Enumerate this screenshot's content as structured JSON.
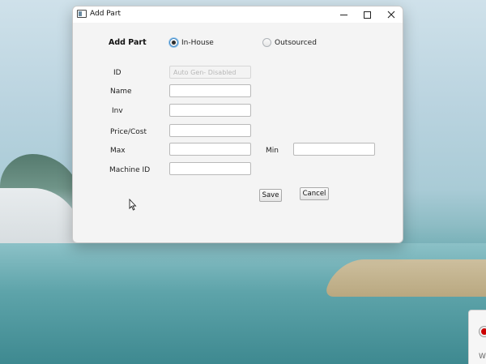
{
  "window": {
    "title": "Add Part",
    "controls": {
      "minimize": "minimize-icon",
      "maximize": "maximize-icon",
      "close": "close-icon"
    }
  },
  "form": {
    "heading": "Add Part",
    "radios": {
      "in_house": {
        "label": "In-House",
        "selected": true
      },
      "outsourced": {
        "label": "Outsourced",
        "selected": false
      }
    },
    "fields": {
      "id": {
        "label": "ID",
        "placeholder": "Auto Gen- Disabled",
        "value": ""
      },
      "name": {
        "label": "Name",
        "value": ""
      },
      "inv": {
        "label": "Inv",
        "value": ""
      },
      "price": {
        "label": "Price/Cost",
        "value": ""
      },
      "max": {
        "label": "Max",
        "value": ""
      },
      "min": {
        "label": "Min",
        "value": ""
      },
      "machine_id": {
        "label": "Machine ID",
        "value": ""
      }
    },
    "buttons": {
      "save": "Save",
      "cancel": "Cancel"
    }
  },
  "taskbar_corner": {
    "letter": "W"
  },
  "colors": {
    "radio_accent": "#3b89c8",
    "window_bg": "#f4f4f4"
  }
}
